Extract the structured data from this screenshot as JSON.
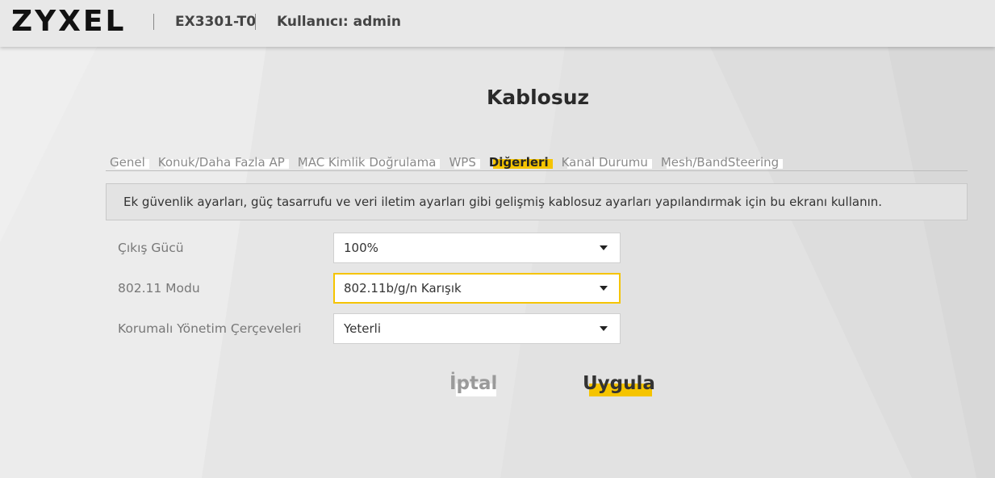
{
  "header": {
    "logo": "ZYXEL",
    "model": "EX3301-T0",
    "user": "Kullanıcı: admin"
  },
  "page": {
    "title": "Kablosuz"
  },
  "tabs": [
    {
      "label": "Genel",
      "active": false
    },
    {
      "label": "Konuk/Daha Fazla AP",
      "active": false
    },
    {
      "label": "MAC Kimlik Doğrulama",
      "active": false
    },
    {
      "label": "WPS",
      "active": false
    },
    {
      "label": "Diğerleri",
      "active": true
    },
    {
      "label": "Kanal Durumu",
      "active": false
    },
    {
      "label": "Mesh/BandSteering",
      "active": false
    }
  ],
  "info": {
    "text": "Ek güvenlik ayarları, güç tasarrufu ve veri iletim ayarları gibi gelişmiş kablosuz ayarları yapılandırmak için bu ekranı kullanın."
  },
  "form": {
    "output_power": {
      "label": "Çıkış Gücü",
      "value": "100%"
    },
    "mode": {
      "label": "802.11 Modu",
      "value": "802.11b/g/n Karışık"
    },
    "pmf": {
      "label": "Korumalı Yönetim Çerçeveleri",
      "value": "Yeterli"
    }
  },
  "buttons": {
    "cancel": "İptal",
    "apply": "Uygula"
  },
  "colors": {
    "accent": "#f5c400",
    "background": "#e9e9e9"
  }
}
